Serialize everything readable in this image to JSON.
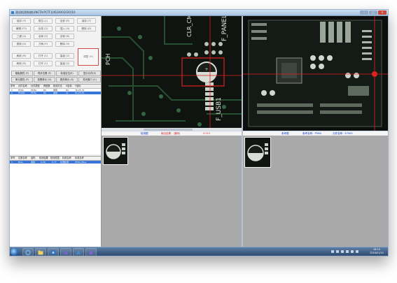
{
  "window": {
    "title": "测试检测系统(UNCTA:PCTF)[4024001020]10"
  },
  "buttons": {
    "grid": [
      [
        "保存 (F)",
        "载位 (L)",
        "全部 (R)",
        "保存 (T)"
      ],
      [
        "编辑 (F2)",
        "比较 (2)",
        "插入 (4)",
        "删除 (D)"
      ],
      [
        "三键 (4)",
        "全局 (5)",
        "总和 (6)"
      ],
      [
        "更新 (0)",
        "刀柄 (Y)",
        "删除 (9)"
      ],
      [
        "刷新 (R)",
        "打开 (1)",
        "高级 (2)"
      ]
    ],
    "side": "调整 (H)",
    "row_a": [
      "模板属性 (F)",
      "同步位置 (F)",
      "标准定位(E)",
      "显示元件(E)"
    ],
    "row_b": [
      "单元属性 (F)",
      "查看单元 (G)",
      "更改单元 (S)",
      "关闭窗口 (C)"
    ]
  },
  "top_table": {
    "headers": [
      "序号",
      "元件名称",
      "元件类型",
      "焊盘数",
      "检测方法",
      "X坐标",
      "Y坐标"
    ],
    "rows": [
      [
        "1",
        "P5HA",
        "P5HA",
        "80",
        "通用",
        "84",
        "76.25.76"
      ],
      [
        "2",
        "P5000",
        "P5HA",
        "80",
        "通用",
        "11",
        "84.25.25"
      ]
    ],
    "selected_row": 1
  },
  "bottom_table": {
    "headers": [
      "序号",
      "位置名称",
      "结构",
      "检测结果",
      "检测范围",
      "标准名称",
      "标准名称"
    ],
    "rows": [
      [
        "1",
        "Blue",
        "通用",
        "0.90",
        "0.77",
        "标准检测",
        "P5HA_Blue"
      ]
    ],
    "selected_row": 0
  },
  "panel_left": {
    "title": "检测图",
    "result_label": "输出结果：(通用)",
    "result_value": "0.013"
  },
  "panel_right": {
    "title": "参考图",
    "ref_name": "参考名称：P5HA",
    "comp_name": "元件名称：E7000"
  },
  "board_labels": {
    "clr": "CLR_CMOS",
    "fpanel": "F_PANEL",
    "fusb": "F_USB1",
    "pch": "PCH"
  },
  "clock": {
    "time": "18:14",
    "date": "2016/01/20"
  },
  "colors": {
    "accent": "#3875d7",
    "marker_red": "#e02020",
    "title_blue": "#0033cc"
  },
  "icons": [
    "start-orb-icon",
    "ie-icon",
    "folder-icon",
    "app-icon-1",
    "app-icon-2",
    "app-icon-3",
    "app-icon-4"
  ]
}
